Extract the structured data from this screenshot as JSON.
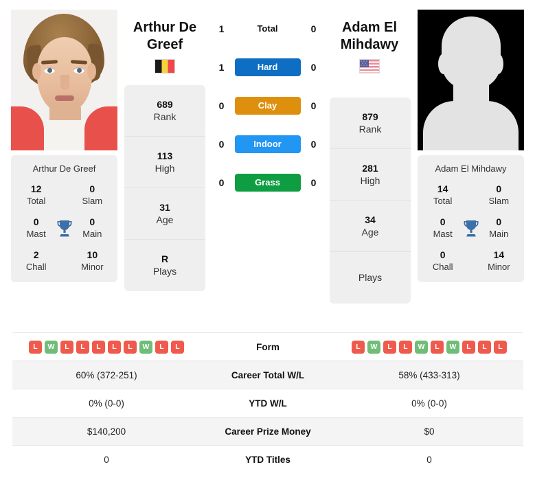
{
  "players": {
    "left": {
      "name_header": "Arthur De Greef",
      "card_name": "Arthur De Greef",
      "country_flag": "belgium-flag",
      "photo": "player-photo",
      "rank": {
        "value": "689",
        "label": "Rank"
      },
      "high": {
        "value": "113",
        "label": "High"
      },
      "age": {
        "value": "31",
        "label": "Age"
      },
      "plays": {
        "value": "R",
        "label": "Plays"
      },
      "titles": {
        "total": {
          "value": "12",
          "label": "Total"
        },
        "slam": {
          "value": "0",
          "label": "Slam"
        },
        "mast": {
          "value": "0",
          "label": "Mast"
        },
        "main": {
          "value": "0",
          "label": "Main"
        },
        "chall": {
          "value": "2",
          "label": "Chall"
        },
        "minor": {
          "value": "10",
          "label": "Minor"
        }
      },
      "form": [
        "L",
        "W",
        "L",
        "L",
        "L",
        "L",
        "L",
        "W",
        "L",
        "L"
      ],
      "career_total_wl": "60% (372-251)",
      "ytd_wl": "0% (0-0)",
      "career_prize_money": "$140,200",
      "ytd_titles": "0"
    },
    "right": {
      "name_header": "Adam El Mihdawy",
      "card_name": "Adam El Mihdawy",
      "country_flag": "usa-flag",
      "photo": "player-photo-placeholder",
      "rank": {
        "value": "879",
        "label": "Rank"
      },
      "high": {
        "value": "281",
        "label": "High"
      },
      "age": {
        "value": "34",
        "label": "Age"
      },
      "plays": {
        "value": "",
        "label": "Plays"
      },
      "titles": {
        "total": {
          "value": "14",
          "label": "Total"
        },
        "slam": {
          "value": "0",
          "label": "Slam"
        },
        "mast": {
          "value": "0",
          "label": "Mast"
        },
        "main": {
          "value": "0",
          "label": "Main"
        },
        "chall": {
          "value": "0",
          "label": "Chall"
        },
        "minor": {
          "value": "14",
          "label": "Minor"
        }
      },
      "form": [
        "L",
        "W",
        "L",
        "L",
        "W",
        "L",
        "W",
        "L",
        "L",
        "L"
      ],
      "career_total_wl": "58% (433-313)",
      "ytd_wl": "0% (0-0)",
      "career_prize_money": "$0",
      "ytd_titles": "0"
    }
  },
  "head_to_head": {
    "rows": [
      {
        "label": "Total",
        "left": "1",
        "right": "0",
        "color": "",
        "plain": true
      },
      {
        "label": "Hard",
        "left": "1",
        "right": "0",
        "color": "#0d6ec4",
        "plain": false
      },
      {
        "label": "Clay",
        "left": "0",
        "right": "0",
        "color": "#de8f0d",
        "plain": false
      },
      {
        "label": "Indoor",
        "left": "0",
        "right": "0",
        "color": "#2196f3",
        "plain": false
      },
      {
        "label": "Grass",
        "left": "0",
        "right": "0",
        "color": "#0e9d41",
        "plain": false
      }
    ]
  },
  "stats_table": {
    "rows": [
      {
        "key": "form",
        "label": "Form"
      },
      {
        "key": "career_total_wl",
        "label": "Career Total W/L"
      },
      {
        "key": "ytd_wl",
        "label": "YTD W/L"
      },
      {
        "key": "career_prize_money",
        "label": "Career Prize Money"
      },
      {
        "key": "ytd_titles",
        "label": "YTD Titles"
      }
    ]
  },
  "colors": {
    "panel_bg": "#efefef",
    "row_alt_bg": "#f4f4f4",
    "win_badge": "#70bd78",
    "loss_badge": "#ef5a4c",
    "trophy": "#3d6fa8"
  }
}
